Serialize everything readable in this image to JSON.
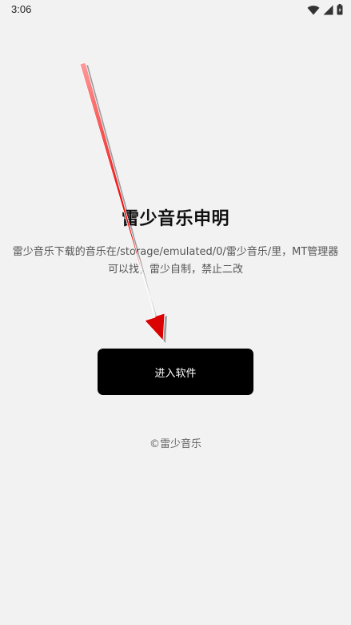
{
  "status_bar": {
    "time": "3:06"
  },
  "main": {
    "title": "雷少音乐申明",
    "description_line1": "雷少音乐下载的音乐在/storage/emulated/0/雷少音乐/里，MT管理器",
    "description_line2": "可以找，雷少自制，禁止二改",
    "enter_button_label": "进入软件",
    "copyright": "©雷少音乐"
  },
  "colors": {
    "background": "#f2f2f2",
    "button_bg": "#000000",
    "button_text": "#ffffff",
    "arrow": "#e00000"
  },
  "icons": [
    "wifi-icon",
    "signal-icon",
    "battery-icon"
  ]
}
